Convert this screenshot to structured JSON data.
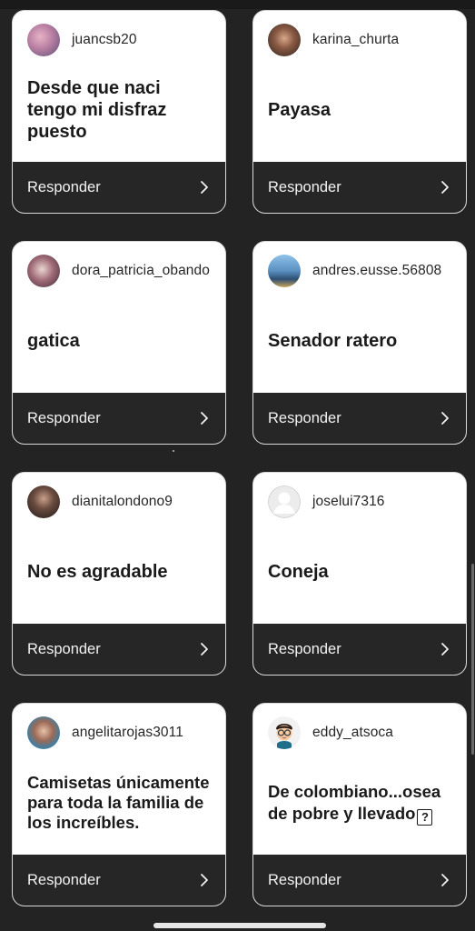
{
  "reply_label": "Responder",
  "cards": [
    {
      "username": "juancsb20",
      "question": "Desde que naci tengo mi disfraz puesto",
      "avatar": "photo-avatar-icon"
    },
    {
      "username": "karina_churta",
      "question": "Payasa",
      "avatar": "photo-avatar-icon"
    },
    {
      "username": "dora_patricia_obando",
      "question": "gatica",
      "avatar": "photo-avatar-icon"
    },
    {
      "username": "andres.eusse.56808",
      "question": "Senador ratero",
      "avatar": "photo-avatar-icon"
    },
    {
      "username": "dianitalondono9",
      "question": "No es agradable",
      "avatar": "photo-avatar-icon"
    },
    {
      "username": "joselui7316",
      "question": "Coneja",
      "avatar": "default-avatar-icon"
    },
    {
      "username": "angelitarojas3011",
      "question": "Camisetas únicamente para toda la familia de los increíbles.",
      "avatar": "photo-avatar-icon"
    },
    {
      "username": "eddy_atsoca",
      "question": "De colombiano...osea de pobre y llevado",
      "question_glyph": "?",
      "avatar": "memoji-avatar-icon"
    }
  ]
}
